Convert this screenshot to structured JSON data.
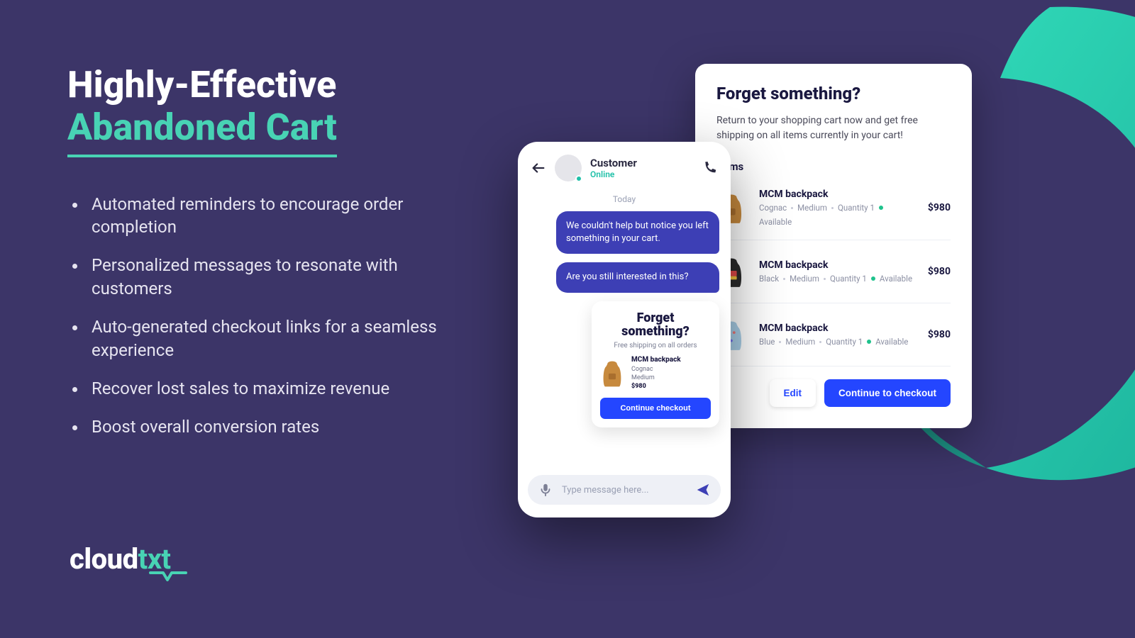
{
  "headline": {
    "line1": "Highly-Effective",
    "line2": "Abandoned Cart"
  },
  "bullets": [
    "Automated reminders to encourage order completion",
    "Personalized messages to resonate with customers",
    "Auto-generated checkout links for a seamless experience",
    "Recover lost sales to maximize revenue",
    "Boost overall conversion rates"
  ],
  "logo": {
    "part1": "cloud",
    "part2": "txt"
  },
  "email": {
    "title": "Forget something?",
    "subtitle": "Return to your shopping cart now and get free shipping on all items currently in your cart!",
    "section": "Items",
    "edit": "Edit",
    "checkout": "Continue to checkout",
    "items": [
      {
        "name": "MCM backpack",
        "color": "Cognac",
        "size": "Medium",
        "qty": "Quantity 1",
        "avail": "Available",
        "price": "$980"
      },
      {
        "name": "MCM backpack",
        "color": "Black",
        "size": "Medium",
        "qty": "Quantity 1",
        "avail": "Available",
        "price": "$980"
      },
      {
        "name": "MCM backpack",
        "color": "Blue",
        "size": "Medium",
        "qty": "Quantity 1",
        "avail": "Available",
        "price": "$980"
      }
    ]
  },
  "chat": {
    "customer": "Customer",
    "status": "Online",
    "day": "Today",
    "msg1": "We couldn't help but notice you left something in your cart.",
    "msg2": "Are you still interested in this?",
    "mini": {
      "titleA": "Forget",
      "titleB": "something?",
      "ship": "Free shipping on all orders",
      "name": "MCM backpack",
      "color": "Cognac",
      "size": "Medium",
      "price": "$980",
      "btn": "Continue checkout"
    },
    "placeholder": "Type message here..."
  },
  "colors": {
    "bg": "#3c3568",
    "accent": "#48d3b4",
    "primary": "#2446ff",
    "bubble": "#3d3fb5"
  }
}
